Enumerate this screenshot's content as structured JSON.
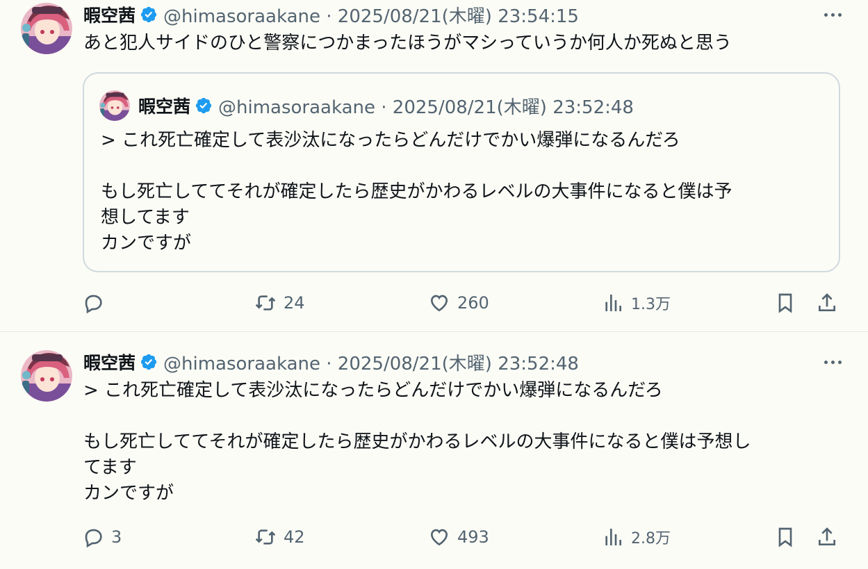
{
  "colors": {
    "background": "#fcfcf6",
    "text": "#0f1419",
    "secondary": "#536471",
    "verified": "#1d9bf0",
    "border": "#cfd9de"
  },
  "tweets": [
    {
      "name": "暇空茜",
      "handle_time": "@himasoraakane · 2025/08/21(木曜) 23:54:15",
      "text": "あと犯人サイドのひと警察につかまったほうがマシっていうか何人か死ぬと思う",
      "quote": {
        "name": "暇空茜",
        "handle_time": "@himasoraakane · 2025/08/21(木曜) 23:52:48",
        "text": "> これ死亡確定して表沙汰になったらどんだけでかい爆弾になるんだろ\n\nもし死亡しててそれが確定したら歴史がかわるレベルの大事件になると僕は予\n想してます\nカンですが"
      },
      "replies": "",
      "retweets": "24",
      "likes": "260",
      "views": "1.3万"
    },
    {
      "name": "暇空茜",
      "handle_time": "@himasoraakane · 2025/08/21(木曜) 23:52:48",
      "text": "> これ死亡確定して表沙汰になったらどんだけでかい爆弾になるんだろ\n\nもし死亡しててそれが確定したら歴史がかわるレベルの大事件になると僕は予想し\nてます\nカンですが",
      "replies": "3",
      "retweets": "42",
      "likes": "493",
      "views": "2.8万"
    }
  ],
  "icons": [
    "verified-badge-icon",
    "more-icon",
    "reply-icon",
    "retweet-icon",
    "like-icon",
    "views-icon",
    "bookmark-icon",
    "share-icon"
  ]
}
